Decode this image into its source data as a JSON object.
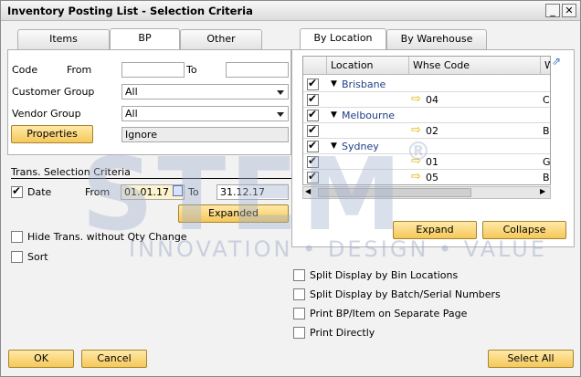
{
  "window": {
    "title": "Inventory Posting List - Selection Criteria"
  },
  "left_tabs": [
    "Items",
    "BP",
    "Other"
  ],
  "bp": {
    "code_label": "Code",
    "from_label": "From",
    "to_label": "To",
    "code_from": "",
    "code_to": "",
    "customer_group_label": "Customer Group",
    "customer_group_value": "All",
    "vendor_group_label": "Vendor Group",
    "vendor_group_value": "All",
    "properties_label": "Properties",
    "properties_value": "Ignore"
  },
  "trans": {
    "header": "Trans. Selection Criteria",
    "date_label": "Date",
    "from_label": "From",
    "from_value": "01.01.17",
    "to_label": "To",
    "to_value": "31.12.17",
    "expanded_label": "Expanded",
    "hide_label": "Hide Trans. without Qty Change",
    "sort_label": "Sort"
  },
  "right_tabs": [
    "By Location",
    "By Warehouse"
  ],
  "grid": {
    "headers": [
      "Location",
      "Whse Code",
      "W"
    ],
    "rows": [
      {
        "type": "group",
        "label": "Brisbane"
      },
      {
        "type": "item",
        "code": "04",
        "desc": "Co"
      },
      {
        "type": "group",
        "label": "Melbourne"
      },
      {
        "type": "item",
        "code": "02",
        "desc": "Ba"
      },
      {
        "type": "group",
        "label": "Sydney"
      },
      {
        "type": "item",
        "code": "01",
        "desc": "Gr"
      },
      {
        "type": "item",
        "code": "05",
        "desc": "Bi"
      }
    ]
  },
  "grid_buttons": {
    "expand": "Expand",
    "collapse": "Collapse"
  },
  "options": {
    "split_bin": "Split Display by Bin Locations",
    "split_batch": "Split Display by Batch/Serial Numbers",
    "print_bp": "Print BP/Item on Separate Page",
    "print_direct": "Print Directly"
  },
  "footer": {
    "ok": "OK",
    "cancel": "Cancel",
    "select_all": "Select All"
  },
  "watermark": {
    "logo": "STEM",
    "tagline": "INNOVATION • DESIGN • VALUE",
    "registered": "®"
  },
  "colors": {
    "accent_button": "#f5c85a",
    "link_blue": "#1f3f86"
  }
}
